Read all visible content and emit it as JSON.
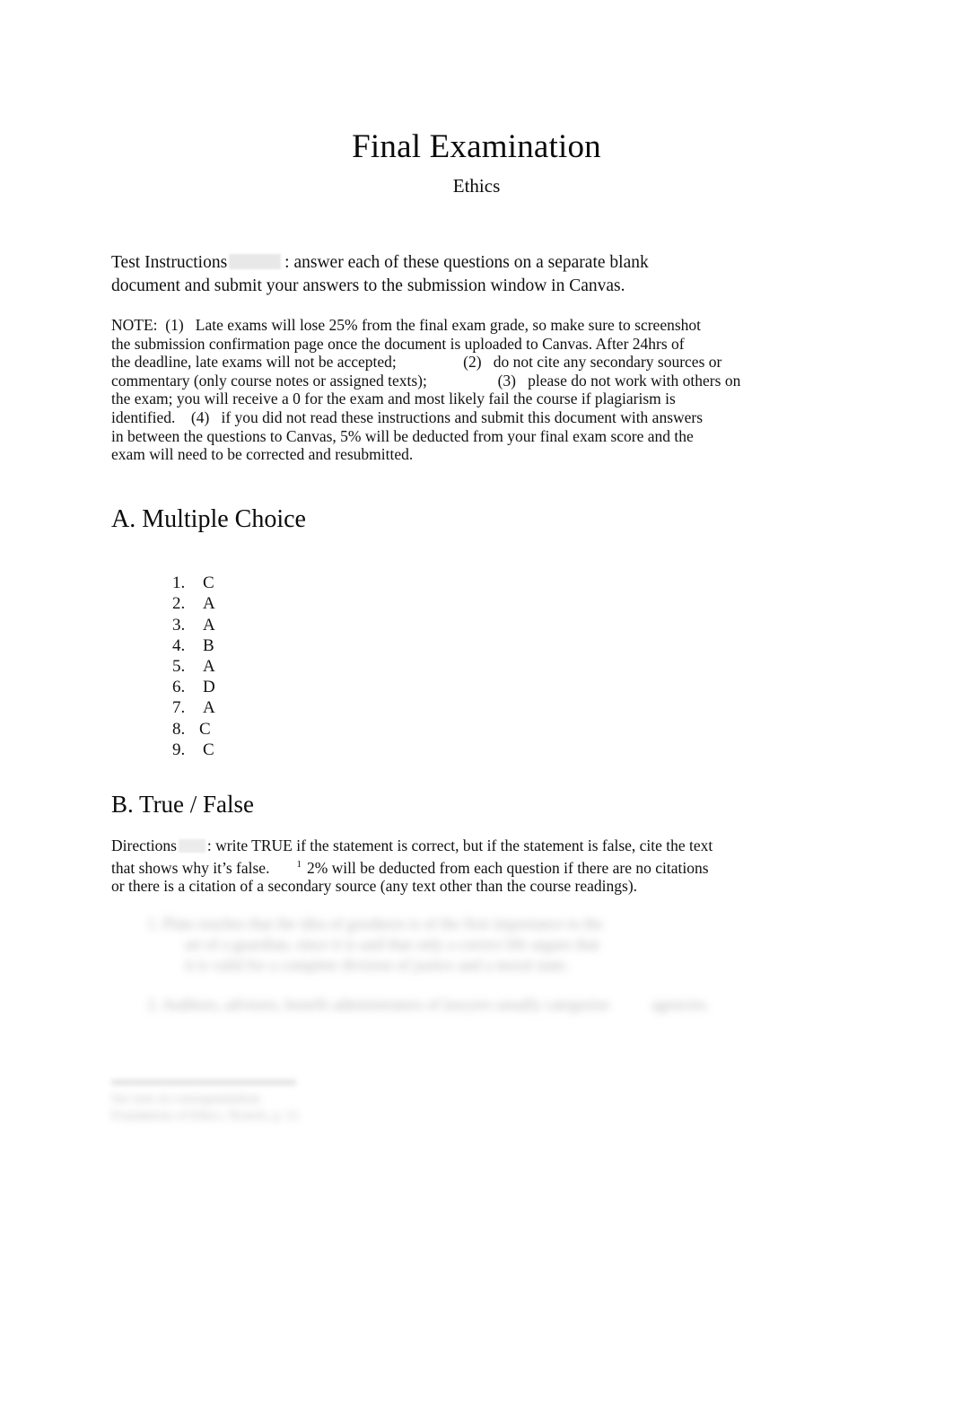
{
  "document": {
    "title": "Final Examination",
    "subtitle": "Ethics"
  },
  "instructions": {
    "label": "Test Instructions",
    "redaction": "",
    "separator": ":",
    "text": "answer each of these questions on a separate blank document and submit your answers to the submission window in Canvas.",
    "line1": "Test Instructions",
    "line1_tail": ":  answer each of these questions on a separate blank",
    "line2": "document and submit your answers to the submission window in Canvas."
  },
  "note": {
    "lines": [
      "NOTE:  (1)   Late exams will lose 25% from the final exam grade, so make sure to screenshot",
      "the submission confirmation page once the document is uploaded to Canvas. After 24hrs of",
      "the deadline, late exams will not be accepted;                 (2)   do not cite any secondary sources or",
      "commentary (only course notes or assigned texts);                  (3)   please do not work with others on",
      "the exam; you will receive a 0 for the exam and most likely fail the course if plagiarism is",
      "identified.    (4)   if you did not read these instructions and submit this document with answers",
      "in between the questions to Canvas, 5% will be deducted from your final exam score and the",
      "exam will need to be corrected and resubmitted."
    ]
  },
  "sections": {
    "multiple_choice": {
      "heading": "A. Multiple Choice",
      "answers": [
        {
          "number": "1.",
          "answer": "C"
        },
        {
          "number": "2.",
          "answer": "A"
        },
        {
          "number": "3.",
          "answer": "A"
        },
        {
          "number": "4.",
          "answer": "B"
        },
        {
          "number": "5.",
          "answer": "A"
        },
        {
          "number": "6.",
          "answer": "D"
        },
        {
          "number": "7.",
          "answer": "A"
        },
        {
          "number": "8.",
          "answer": "C"
        },
        {
          "number": "9.",
          "answer": "C"
        }
      ]
    },
    "true_false": {
      "heading": "B. True / False",
      "directions_label": "Directions",
      "directions_line1": ": write TRUE if the statement is correct, but if the statement is false, cite the text",
      "directions_line2": "that shows why it’s false.",
      "footnote_marker": "1",
      "directions_line2_tail": "2% will be deducted from each question if there are no citations",
      "directions_line3": "or there is a citation of a secondary source (any text other than the course readings).",
      "redacted_items": [
        {
          "line1": "1. Plato teaches that the idea of goodness is of the first importance to the",
          "line2": "art of a guardian, since it is said that only a correct life argues that",
          "line3": "it is valid for a complete division of justice and a moral state."
        },
        {
          "line1": "2. Auditors, advisors, benefit administrators of lawyers usually categorize",
          "line2": "agencies."
        }
      ]
    }
  },
  "footnote": {
    "text_line1": "See note on consequentialism",
    "text_line2": "Foundations of Ethics, Nichols, p. 12"
  }
}
